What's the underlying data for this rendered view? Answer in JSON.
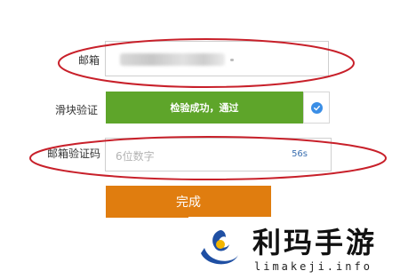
{
  "form": {
    "email_label": "邮箱",
    "slider_label": "滑块验证",
    "slider_text": "检验成功，通过",
    "code_label": "邮箱验证码",
    "code_placeholder": "6位数字",
    "code_timer": "56s",
    "submit_label": "完成"
  },
  "colors": {
    "slider_green": "#5ea52a",
    "button_orange": "#e07d0f",
    "annotation_red": "#c8202a",
    "check_blue": "#3a8ee6"
  },
  "watermark": {
    "title": "利玛手游",
    "subtitle": "limakeji.info"
  }
}
